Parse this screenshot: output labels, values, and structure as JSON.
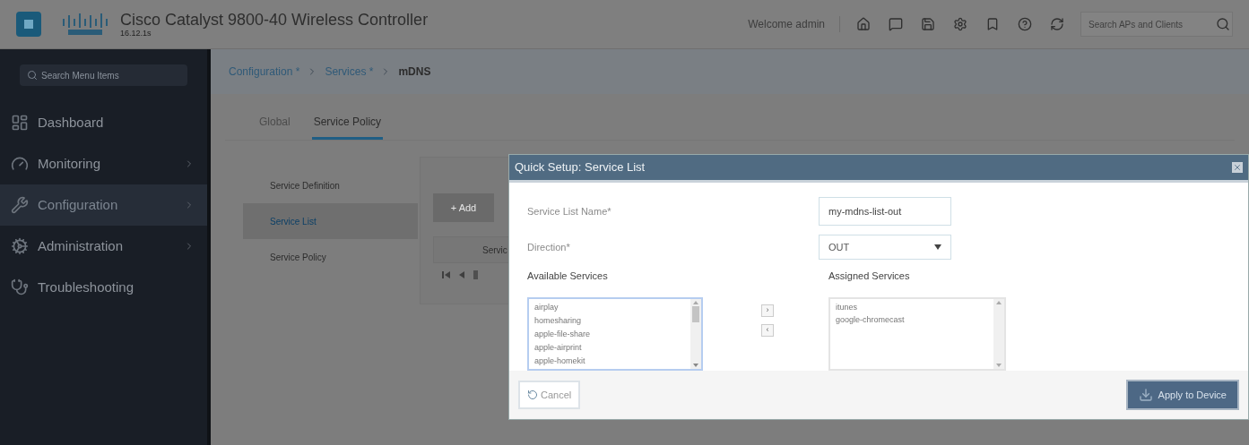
{
  "header": {
    "title": "Cisco Catalyst 9800-40 Wireless Controller",
    "version": "16.12.1s",
    "welcome": "Welcome admin",
    "search_placeholder": "Search APs and Clients"
  },
  "sidebar": {
    "search_placeholder": "Search Menu Items",
    "items": [
      {
        "label": "Dashboard",
        "kind": "dashboard",
        "selected": false,
        "arrow": false
      },
      {
        "label": "Monitoring",
        "kind": "monitoring",
        "selected": false,
        "arrow": true
      },
      {
        "label": "Configuration",
        "kind": "configuration",
        "selected": true,
        "arrow": true
      },
      {
        "label": "Administration",
        "kind": "administration",
        "selected": false,
        "arrow": true
      },
      {
        "label": "Troubleshooting",
        "kind": "troubleshooting",
        "selected": false,
        "arrow": false
      }
    ]
  },
  "breadcrumb": [
    "Configuration *",
    "Services *",
    "mDNS"
  ],
  "tabs": [
    {
      "label": "Global",
      "selected": false
    },
    {
      "label": "Service Policy",
      "selected": true
    }
  ],
  "left_menu": [
    {
      "label": "Service Definition",
      "selected": false
    },
    {
      "label": "Service List",
      "selected": true
    },
    {
      "label": "Service Policy",
      "selected": false
    }
  ],
  "card": {
    "add_button": "+ Add",
    "column_1": "Servic"
  },
  "dialog": {
    "title": "Quick Setup: Service List",
    "name_label": "Service List Name*",
    "name_value": "my-mdns-list-out",
    "direction_label": "Direction*",
    "direction_value": "OUT",
    "available_label": "Available Services",
    "available": [
      "airplay",
      "homesharing",
      "apple-file-share",
      "apple-airprint",
      "apple-homekit"
    ],
    "move_right": "›",
    "move_left": "‹",
    "assigned_label": "Assigned Services",
    "assigned": [
      "itunes",
      "google-chromecast"
    ],
    "cancel": "Cancel",
    "apply": "Apply to Device"
  }
}
